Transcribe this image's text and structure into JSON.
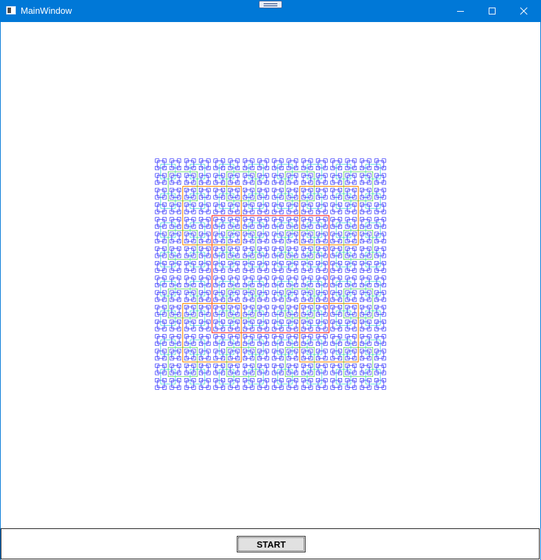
{
  "window": {
    "title": "MainWindow",
    "titlebar_color": "#0078d7",
    "icons": [
      "app-icon",
      "minimize-icon",
      "maximize-icon",
      "close-icon"
    ]
  },
  "canvas": {
    "description_colors": [
      "#ff0000",
      "#ff8800",
      "#22cc22",
      "#00cccc",
      "#0000ff"
    ]
  },
  "toolbar": {
    "start_label": "START"
  }
}
